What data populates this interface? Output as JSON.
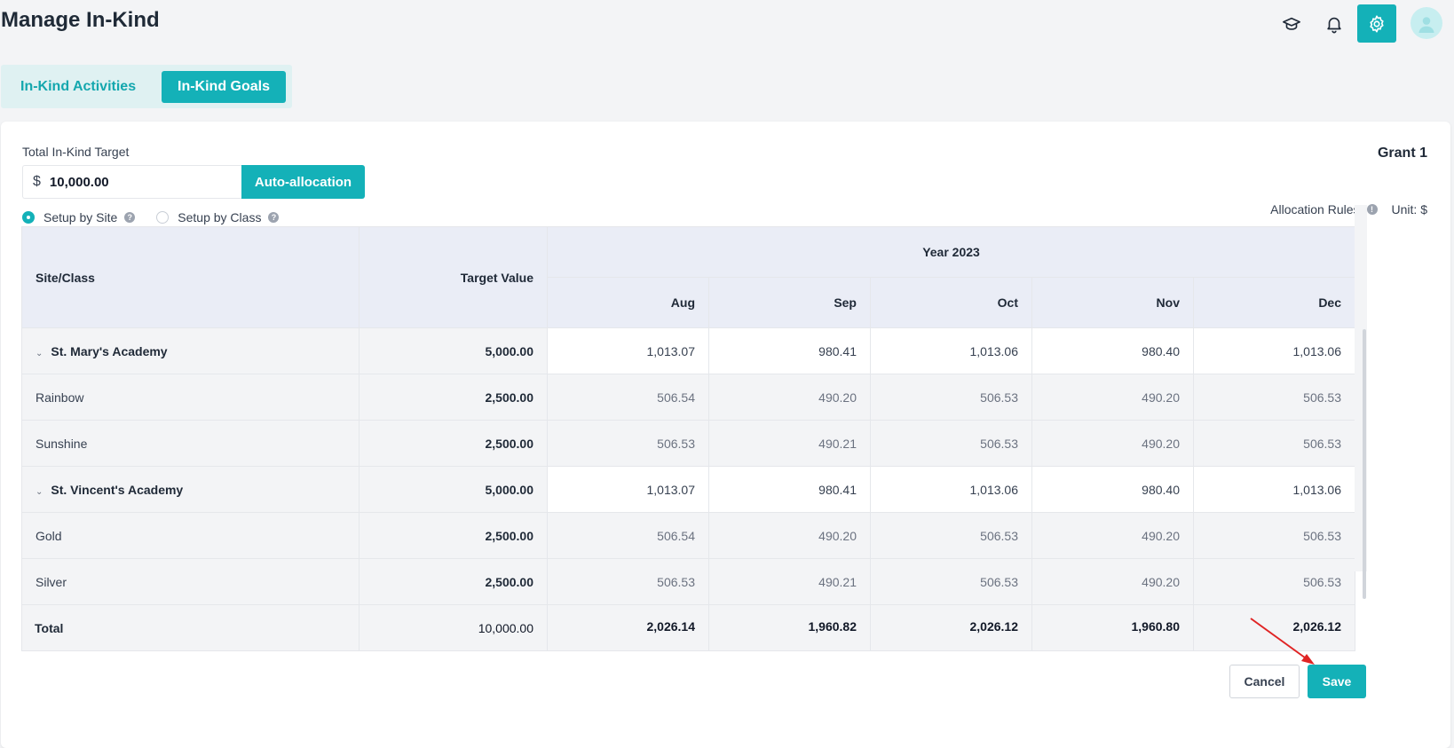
{
  "page": {
    "title": "Manage In-Kind"
  },
  "top_icons": [
    "graduation-cap-icon",
    "bell-icon",
    "gear-icon",
    "user-avatar"
  ],
  "colors": {
    "accent": "#14b1b8",
    "header_bg": "#eaedf6",
    "page_bg": "#f3f4f6"
  },
  "tabs": [
    {
      "label": "In-Kind Activities",
      "active": false
    },
    {
      "label": "In-Kind Goals",
      "active": true
    }
  ],
  "form": {
    "target_label": "Total In-Kind Target",
    "currency_symbol": "$",
    "target_value": "10,000.00",
    "auto_allocation_label": "Auto-allocation",
    "radio": [
      {
        "label": "Setup by Site",
        "checked": true
      },
      {
        "label": "Setup by Class",
        "checked": false
      }
    ],
    "help_glyph": "?",
    "info_glyph": "!"
  },
  "grant": {
    "title": "Grant 1",
    "allocation_rules": "Allocation Rules",
    "unit": "Unit: $"
  },
  "table": {
    "col_site": "Site/Class",
    "col_target": "Target Value",
    "year_label": "Year 2023",
    "months": [
      "Aug",
      "Sep",
      "Oct",
      "Nov",
      "Dec"
    ],
    "rows": [
      {
        "type": "site",
        "name": "St. Mary's Academy",
        "target": "5,000.00",
        "values": [
          "1,013.07",
          "980.41",
          "1,013.06",
          "980.40",
          "1,013.06"
        ]
      },
      {
        "type": "class",
        "name": "Rainbow",
        "target": "2,500.00",
        "values": [
          "506.54",
          "490.20",
          "506.53",
          "490.20",
          "506.53"
        ]
      },
      {
        "type": "class",
        "name": "Sunshine",
        "target": "2,500.00",
        "values": [
          "506.53",
          "490.21",
          "506.53",
          "490.20",
          "506.53"
        ]
      },
      {
        "type": "site",
        "name": "St. Vincent's Academy",
        "target": "5,000.00",
        "values": [
          "1,013.07",
          "980.41",
          "1,013.06",
          "980.40",
          "1,013.06"
        ]
      },
      {
        "type": "class",
        "name": "Gold",
        "target": "2,500.00",
        "values": [
          "506.54",
          "490.20",
          "506.53",
          "490.20",
          "506.53"
        ]
      },
      {
        "type": "class",
        "name": "Silver",
        "target": "2,500.00",
        "values": [
          "506.53",
          "490.21",
          "506.53",
          "490.20",
          "506.53"
        ]
      }
    ],
    "total": {
      "name": "Total",
      "target": "10,000.00",
      "values": [
        "2,026.14",
        "1,960.82",
        "2,026.12",
        "1,960.80",
        "2,026.12"
      ]
    }
  },
  "actions": {
    "cancel_label": "Cancel",
    "save_label": "Save"
  },
  "annotation": {
    "arrow_color": "#e02424",
    "points_to": "save-button"
  }
}
